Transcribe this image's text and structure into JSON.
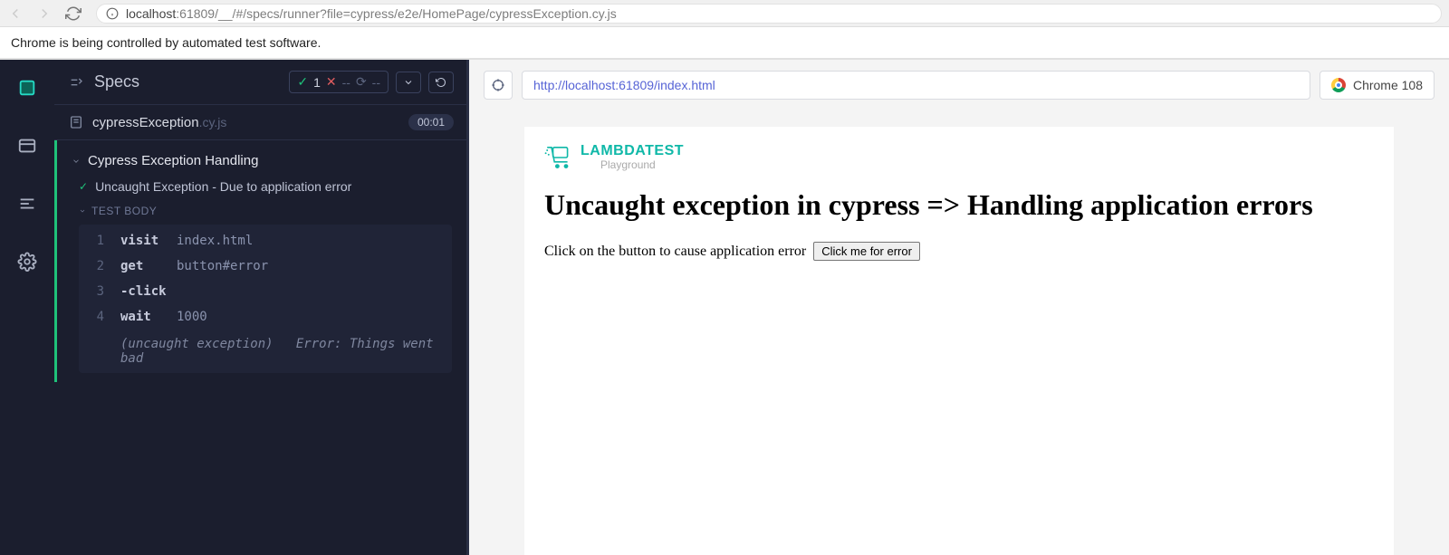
{
  "chrome": {
    "url_host": "localhost",
    "url_port_path": ":61809/__/#/specs/runner?file=cypress/e2e/HomePage/cypressException.cy.js",
    "automation_msg": "Chrome is being controlled by automated test software."
  },
  "panel": {
    "title": "Specs",
    "stats": {
      "pass": "1",
      "fail": "--",
      "pending": "--"
    },
    "file_name": "cypressException",
    "file_ext": ".cy.js",
    "timer": "00:01",
    "describe": "Cypress Exception Handling",
    "test": "Uncaught Exception - Due to application error",
    "body_label": "TEST BODY",
    "commands": [
      {
        "n": "1",
        "name": "visit",
        "arg": "index.html"
      },
      {
        "n": "2",
        "name": "get",
        "arg": "button#error"
      },
      {
        "n": "3",
        "name": "-click",
        "arg": ""
      },
      {
        "n": "4",
        "name": "wait",
        "arg": "1000"
      }
    ],
    "exception_label": "(uncaught exception)",
    "exception_msg": "Error: Things went bad"
  },
  "preview": {
    "url": "http://localhost:61809/index.html",
    "browser": "Chrome 108"
  },
  "aut": {
    "logo_brand": "LAMBDATEST",
    "logo_sub": "Playground",
    "heading": "Uncaught exception in cypress => Handling application errors",
    "line": "Click on the button to cause application error",
    "button": "Click me for error"
  }
}
